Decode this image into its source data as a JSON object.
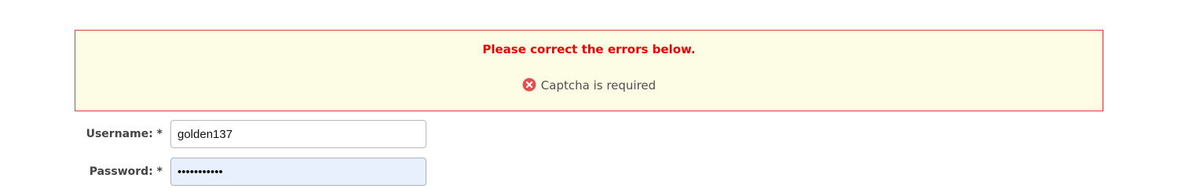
{
  "errors": {
    "title": "Please correct the errors below.",
    "items": [
      {
        "icon": "error-circle-icon",
        "text": "Captcha is required"
      }
    ]
  },
  "form": {
    "username": {
      "label": "Username: *",
      "value": "golden137"
    },
    "password": {
      "label": "Password: *",
      "value": "•••••••••••"
    }
  },
  "colors": {
    "error_text": "#ee0000",
    "error_border": "#e23b3b",
    "error_background": "#fdfde6",
    "error_icon": "#e05252",
    "autofill_background": "#e8f0fe"
  }
}
